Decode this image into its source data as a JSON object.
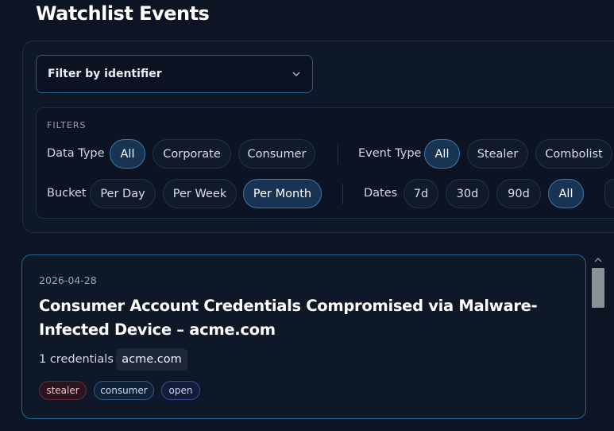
{
  "page": {
    "title": "Watchlist Events"
  },
  "identifier_filter": {
    "label": "Filter by identifier"
  },
  "filters": {
    "heading": "FILTERS",
    "data_type": {
      "label": "Data Type",
      "options": [
        "All",
        "Corporate",
        "Consumer"
      ],
      "selected": "All"
    },
    "event_type": {
      "label": "Event Type",
      "options": [
        "All",
        "Stealer",
        "Combolist"
      ],
      "selected": "All"
    },
    "bucket": {
      "label": "Bucket",
      "options": [
        "Per Day",
        "Per Week",
        "Per Month"
      ],
      "selected": "Per Month"
    },
    "dates": {
      "label": "Dates",
      "options": [
        "7d",
        "30d",
        "90d",
        "All"
      ],
      "selected": "All"
    }
  },
  "events": [
    {
      "date": "2026-04-28",
      "title": "Consumer Account Credentials Compromised via Malware-Infected Device – acme.com",
      "credentials": "1 credentials",
      "domain": "acme.com",
      "tags": [
        "stealer",
        "consumer",
        "open"
      ]
    }
  ],
  "colors": {
    "accent": "#3d78ad",
    "background": "#0d1525",
    "stealer": "#6b2a36",
    "consumer": "#2a5a86",
    "open": "#3a4a96"
  }
}
